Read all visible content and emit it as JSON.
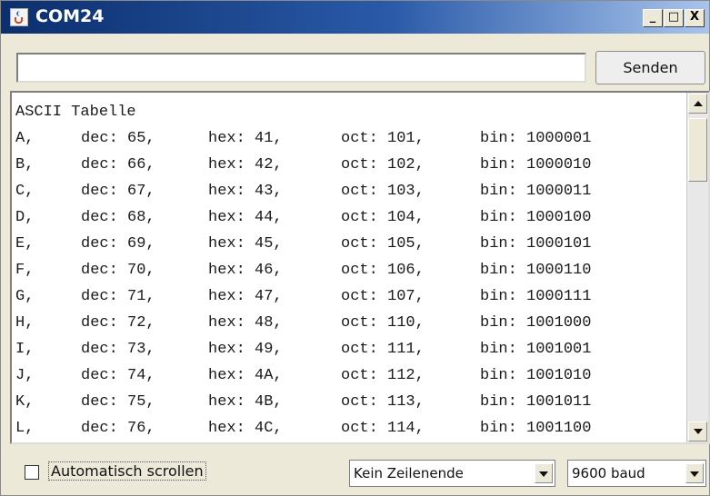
{
  "window": {
    "title": "COM24",
    "controls": {
      "minimize": "_",
      "maximize": "□",
      "close": "X"
    }
  },
  "send": {
    "input_value": "",
    "button_label": "Senden"
  },
  "output": {
    "header": "ASCII Tabelle",
    "rows": [
      [
        "A,",
        "dec: 65,",
        "hex: 41,",
        "oct: 101,",
        "bin: 1000001"
      ],
      [
        "B,",
        "dec: 66,",
        "hex: 42,",
        "oct: 102,",
        "bin: 1000010"
      ],
      [
        "C,",
        "dec: 67,",
        "hex: 43,",
        "oct: 103,",
        "bin: 1000011"
      ],
      [
        "D,",
        "dec: 68,",
        "hex: 44,",
        "oct: 104,",
        "bin: 1000100"
      ],
      [
        "E,",
        "dec: 69,",
        "hex: 45,",
        "oct: 105,",
        "bin: 1000101"
      ],
      [
        "F,",
        "dec: 70,",
        "hex: 46,",
        "oct: 106,",
        "bin: 1000110"
      ],
      [
        "G,",
        "dec: 71,",
        "hex: 47,",
        "oct: 107,",
        "bin: 1000111"
      ],
      [
        "H,",
        "dec: 72,",
        "hex: 48,",
        "oct: 110,",
        "bin: 1001000"
      ],
      [
        "I,",
        "dec: 73,",
        "hex: 49,",
        "oct: 111,",
        "bin: 1001001"
      ],
      [
        "J,",
        "dec: 74,",
        "hex: 4A,",
        "oct: 112,",
        "bin: 1001010"
      ],
      [
        "K,",
        "dec: 75,",
        "hex: 4B,",
        "oct: 113,",
        "bin: 1001011"
      ],
      [
        "L,",
        "dec: 76,",
        "hex: 4C,",
        "oct: 114,",
        "bin: 1001100"
      ]
    ]
  },
  "footer": {
    "autoscroll_label": "Automatisch scrollen",
    "autoscroll_checked": false,
    "line_ending": "Kein Zeilenende",
    "baud_rate": "9600 baud"
  },
  "icons": {
    "app": "java-cup-icon",
    "scroll_up": "arrow-up-icon",
    "scroll_down": "arrow-down-icon",
    "dropdown": "chevron-down-icon"
  }
}
